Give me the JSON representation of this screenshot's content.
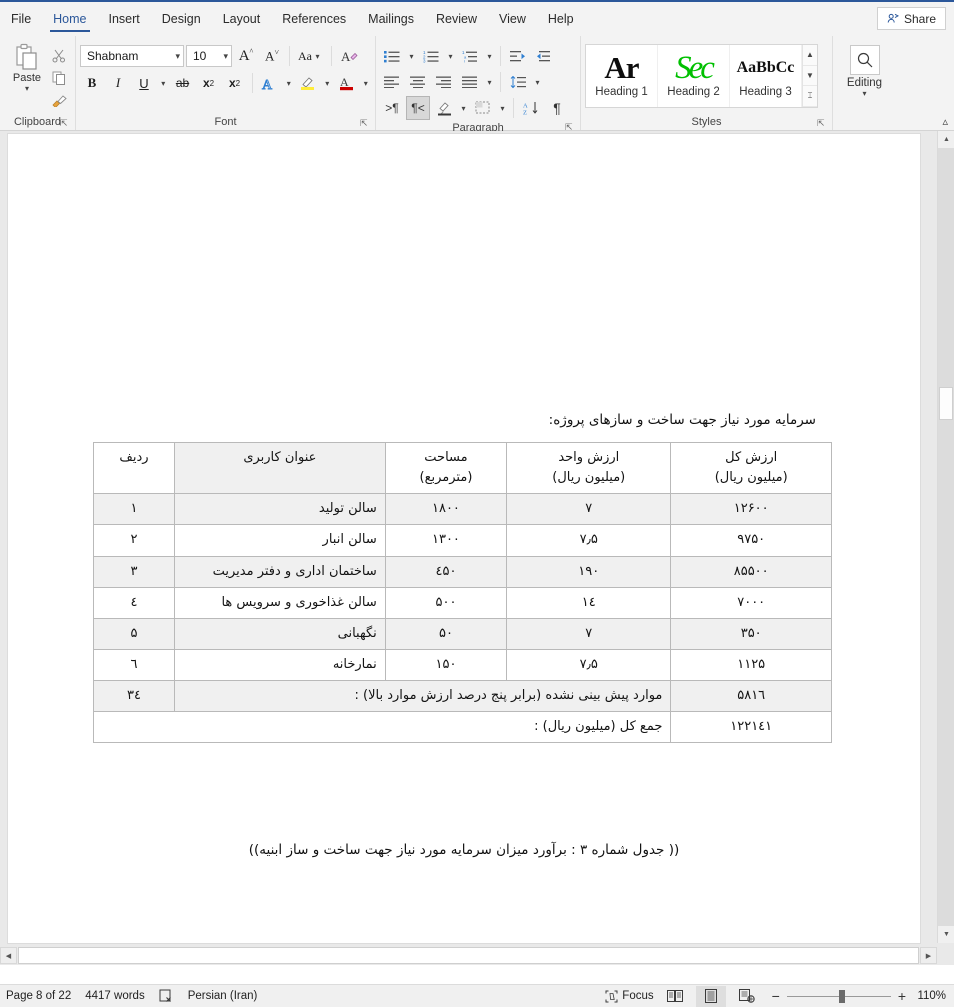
{
  "tabs": [
    {
      "label": "File",
      "active": false
    },
    {
      "label": "Home",
      "active": true
    },
    {
      "label": "Insert",
      "active": false
    },
    {
      "label": "Design",
      "active": false
    },
    {
      "label": "Layout",
      "active": false
    },
    {
      "label": "References",
      "active": false
    },
    {
      "label": "Mailings",
      "active": false
    },
    {
      "label": "Review",
      "active": false
    },
    {
      "label": "View",
      "active": false
    },
    {
      "label": "Help",
      "active": false
    }
  ],
  "share": {
    "label": "Share",
    "icon": "share-person-icon"
  },
  "ribbon": {
    "clipboard": {
      "label": "Clipboard",
      "paste_label": "Paste",
      "paste_icon": "paste-icon",
      "cut_icon": "scissors-icon",
      "copy_icon": "copy-icon",
      "format_painter_icon": "format-painter-icon",
      "launcher": "dialog-launcher-icon"
    },
    "font": {
      "label": "Font",
      "family_value": "Shabnam",
      "size_value": "10",
      "grow_font_icon": "grow-font-icon",
      "shrink_font_icon": "shrink-font-icon",
      "change_case_icon": "change-case-icon",
      "clear_formatting_icon": "clear-formatting-icon",
      "bold_label": "B",
      "italic_label": "I",
      "underline_label": "U",
      "strikethrough_label": "ab",
      "subscript_label": "x",
      "superscript_label": "x",
      "text_effects_icon": "text-effects-icon",
      "highlight_icon": "highlight-color-icon",
      "font_color_icon": "font-color-icon",
      "launcher": "dialog-launcher-icon"
    },
    "paragraph": {
      "label": "Paragraph",
      "bullets_icon": "bullet-list-icon",
      "numbering_icon": "numbered-list-icon",
      "multilevel_icon": "multilevel-list-icon",
      "decrease_indent_icon": "decrease-indent-icon",
      "increase_indent_icon": "increase-indent-icon",
      "align_left_icon": "align-left-icon",
      "align_center_icon": "align-center-icon",
      "align_right_icon": "align-right-icon",
      "justify_icon": "justify-icon",
      "line_spacing_icon": "line-spacing-icon",
      "ltr_icon": "left-to-right-icon",
      "rtl_icon": "right-to-left-icon",
      "shading_icon": "shading-icon",
      "borders_icon": "borders-icon",
      "sort_icon": "sort-icon",
      "show_marks_icon": "show-formatting-marks-icon",
      "launcher": "dialog-launcher-icon"
    },
    "styles": {
      "label": "Styles",
      "items": [
        {
          "name": "Heading 1",
          "preview": "Ar",
          "color": "#0d0d0d"
        },
        {
          "name": "Heading 2",
          "preview": "Sec",
          "color": "#00c000"
        },
        {
          "name": "Heading 3",
          "preview": "AaBbCc",
          "color": "#111111"
        }
      ],
      "launcher": "dialog-launcher-icon"
    },
    "editing": {
      "label": "Editing",
      "icon": "magnifier-icon"
    },
    "collapse_icon": "collapse-ribbon-icon"
  },
  "document": {
    "intro_line": "سرمایه مورد نیاز جهت ساخت و سازهای پروژه:",
    "caption": "(( جدول شماره ۳ : برآورد میزان سرمایه مورد نیاز جهت ساخت و ساز ابنیه))",
    "table": {
      "headers": {
        "num": "ردیف",
        "title": "عنوان کاربری",
        "area_l1": "مساحت",
        "area_l2": "(مترمربع)",
        "unit_l1": "ارزش واحد",
        "unit_l2": "(میلیون ریال)",
        "total_l1": "ارزش کل",
        "total_l2": "(میلیون ریال)"
      },
      "rows": [
        {
          "num": "۱",
          "title": "سالن تولید",
          "area": "۱۸۰۰",
          "unit": "۷",
          "total": "۱۲۶۰۰",
          "tall": false
        },
        {
          "num": "۲",
          "title": "سالن انبار",
          "area": "۱۳۰۰",
          "unit": "۷٫۵",
          "total": "۹۷۵۰",
          "tall": true
        },
        {
          "num": "۳",
          "title": "ساختمان اداری و دفتر مدیریت",
          "area": "٤۵۰",
          "unit": "۱۹۰",
          "total": "۸۵۵۰۰",
          "tall": false
        },
        {
          "num": "٤",
          "title": "سالن غذاخوری و سرویس ها",
          "area": "۵۰۰",
          "unit": "۱٤",
          "total": "۷۰۰۰",
          "tall": false
        },
        {
          "num": "۵",
          "title": "نگهبانی",
          "area": "۵۰",
          "unit": "۷",
          "total": "۳۵۰",
          "tall": false
        },
        {
          "num": "٦",
          "title": "نمارخانه",
          "area": "۱۵۰",
          "unit": "۷٫۵",
          "total": "۱۱۲۵",
          "tall": false
        }
      ],
      "summary_rows": [
        {
          "num": "۳٤",
          "label": "موارد پیش بینی نشده (برابر پنج درصد ارزش موارد بالا) :",
          "total": "۵۸۱٦",
          "tall": false
        },
        {
          "num": "",
          "label": "جمع کل (میلیون ریال) :",
          "total": "۱۲۲۱٤۱",
          "tall": true
        }
      ]
    }
  },
  "status": {
    "page": "Page 8 of 22",
    "words": "4417 words",
    "proofing_icon": "proofing-errors-icon",
    "language": "Persian (Iran)",
    "focus_label": "Focus",
    "focus_icon": "focus-mode-icon",
    "read_mode_icon": "read-mode-icon",
    "print_layout_icon": "print-layout-icon",
    "web_layout_icon": "web-layout-icon",
    "zoom_out_label": "−",
    "zoom_in_label": "+",
    "zoom_value": "110%"
  }
}
